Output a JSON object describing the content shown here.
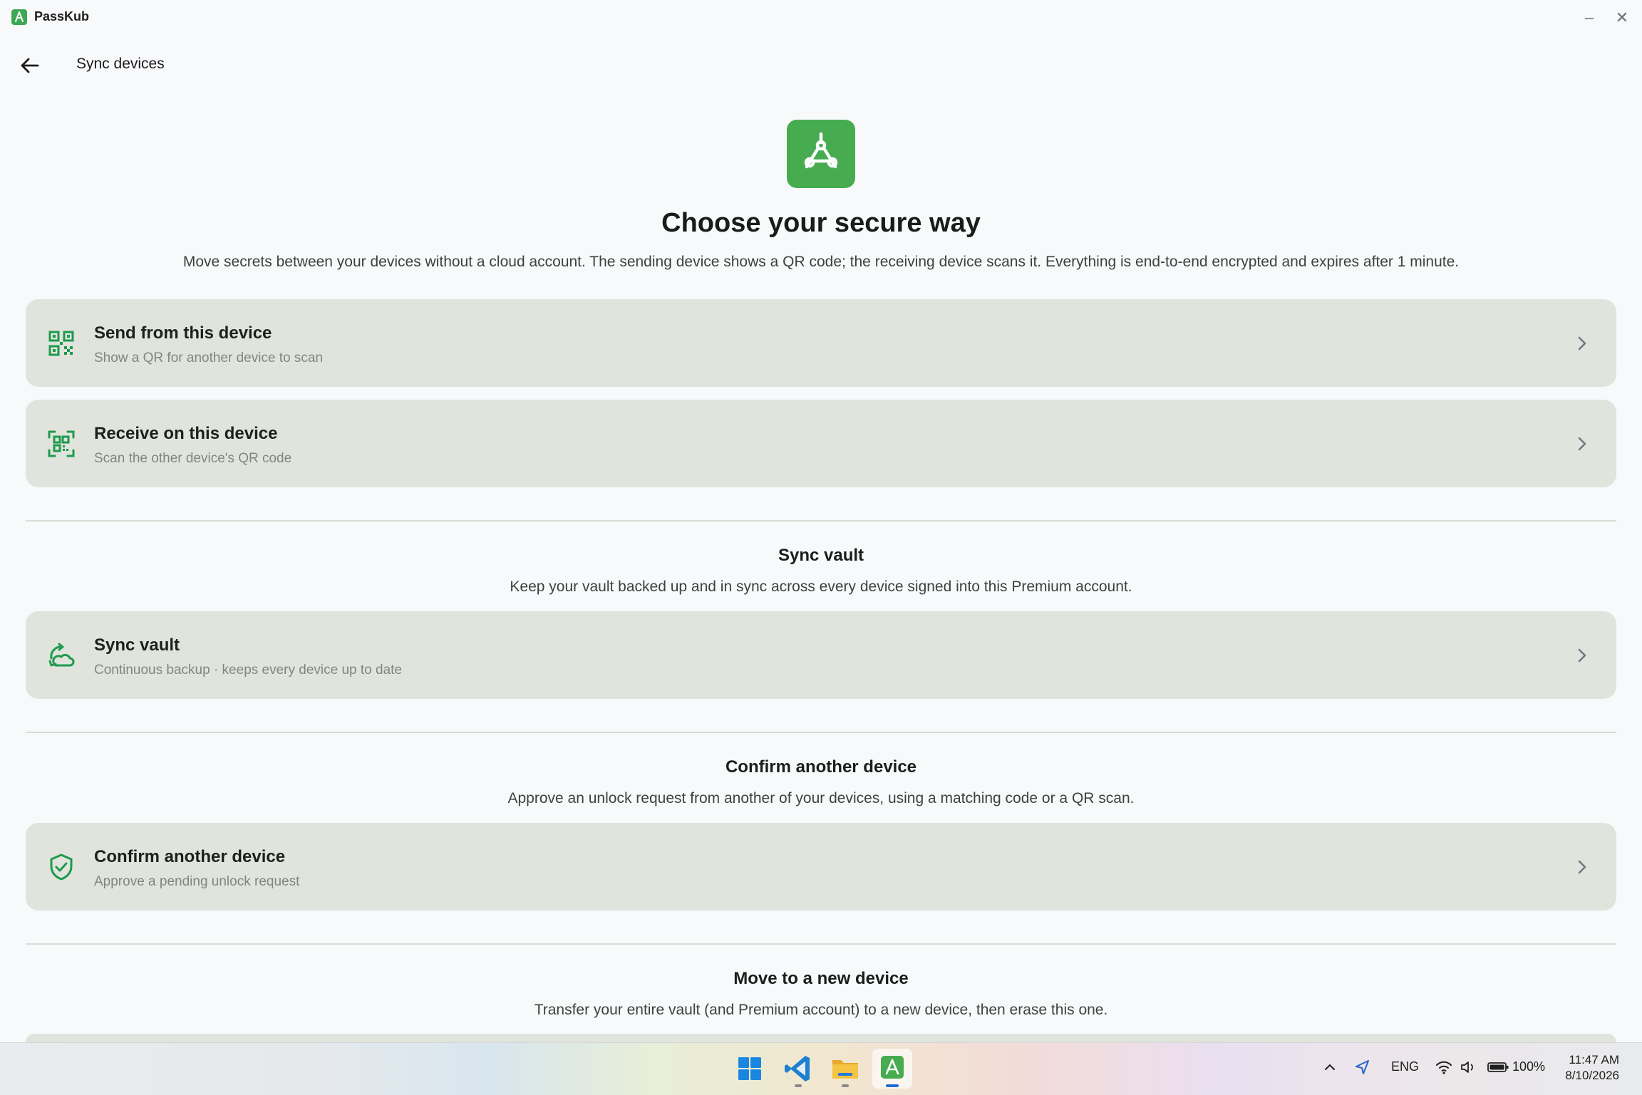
{
  "window": {
    "app_name": "PassKub",
    "minimize_glyph": "–",
    "close_glyph": "✕"
  },
  "header": {
    "title": "Sync devices",
    "back_icon": "arrow-left-icon"
  },
  "hero": {
    "icon": "passkub-logo-icon",
    "title": "Choose your secure way",
    "description": "Move secrets between your devices without a cloud account. The sending device shows a QR code; the receiving device scans it. Everything is end-to-end encrypted and expires after 1 minute."
  },
  "cards": [
    {
      "icon": "qr-code-icon",
      "title": "Send from this device",
      "subtitle": "Show a QR for another device to scan"
    },
    {
      "icon": "qr-scan-icon",
      "title": "Receive on this device",
      "subtitle": "Scan the other device's QR code"
    },
    {
      "icon": "sync-cloud-icon",
      "title": "Sync vault",
      "subtitle": "Continuous backup · keeps every device up to date"
    },
    {
      "icon": "shield-check-icon",
      "title": "Confirm another device",
      "subtitle": "Approve a pending unlock request"
    }
  ],
  "sections": [
    {
      "title": "Sync vault",
      "description": "Keep your vault backed up and in sync across every device signed into this Premium account."
    },
    {
      "title": "Confirm another device",
      "description": "Approve an unlock request from another of your devices, using a matching code or a QR scan."
    },
    {
      "title": "Move to a new device",
      "description": "Transfer your entire vault (and Premium account) to a new device, then erase this one."
    }
  ],
  "taskbar": {
    "apps": [
      "windows-start-icon",
      "vscode-icon",
      "file-explorer-icon",
      "passkub-icon"
    ],
    "tray": {
      "language": "ENG",
      "battery": "100%",
      "time": "11:47 AM",
      "date": "8/10/2026"
    }
  },
  "colors": {
    "accent": "#47ac50",
    "card_bg": "#e1e4dc",
    "icon_green": "#1e9a4e"
  }
}
